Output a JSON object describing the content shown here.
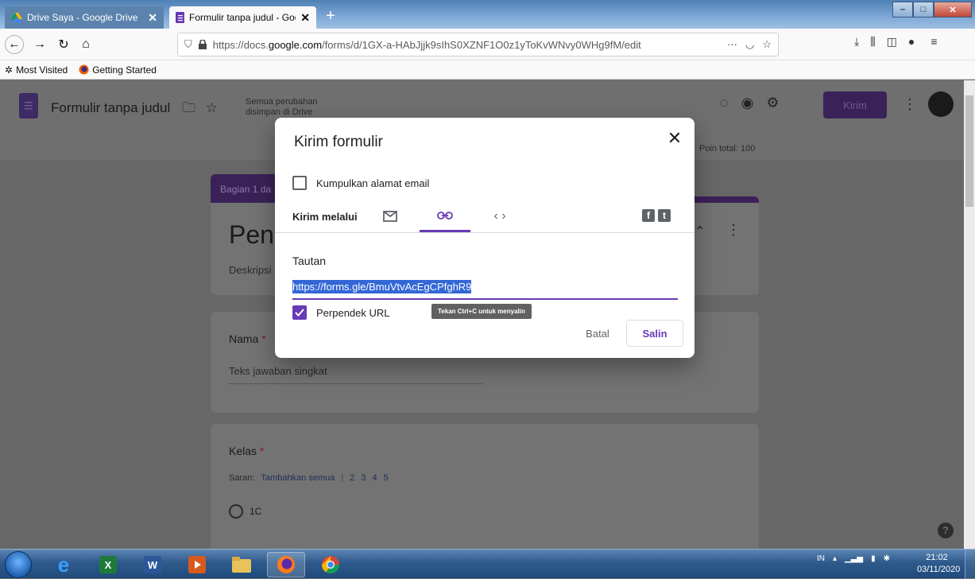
{
  "browser": {
    "tabs": [
      {
        "label": "Drive Saya - Google Drive"
      },
      {
        "label": "Formulir tanpa judul - Google F"
      }
    ],
    "url_prefix": "https://docs.",
    "url_domain": "google.com",
    "url_path": "/forms/d/1GX-a-HAbJjjk9sIhS0XZNF1O0z1yToKvWNvy0WHg9fM/edit",
    "bookmarks": [
      {
        "label": "Most Visited"
      },
      {
        "label": "Getting Started"
      }
    ]
  },
  "forms_header": {
    "doc_title": "Formulir tanpa judul",
    "save_status": "Semua perubahan disimpan di Drive",
    "send_button": "Kirim",
    "points_total": "Poin total: 100"
  },
  "form": {
    "section_tab": "Bagian 1 da",
    "title": "Penil",
    "description": "Deskripsi",
    "questions": [
      {
        "label": "Nama",
        "required": "*",
        "placeholder": "Teks jawaban singkat"
      },
      {
        "label": "Kelas",
        "required": "*"
      }
    ],
    "suggestions": {
      "prefix": "Saran:",
      "add_all": "Tambahkan semua",
      "items": [
        "2",
        "3",
        "4",
        "5"
      ]
    },
    "option_1": "1C"
  },
  "dialog": {
    "title": "Kirim formulir",
    "collect_email": "Kumpulkan alamat email",
    "send_via": "Kirim melalui",
    "link_heading": "Tautan",
    "link_url": "https://forms.gle/BmuVtvAcEgCPfghR9",
    "shorten_url": "Perpendek URL",
    "tooltip": "Tekan Ctrl+C untuk menyalin",
    "cancel": "Batal",
    "copy": "Salin"
  },
  "taskbar": {
    "lang": "IN",
    "time": "21:02",
    "date": "03/11/2020"
  },
  "icons": {
    "accent": "#673ab7",
    "selection": "#3367d6"
  }
}
